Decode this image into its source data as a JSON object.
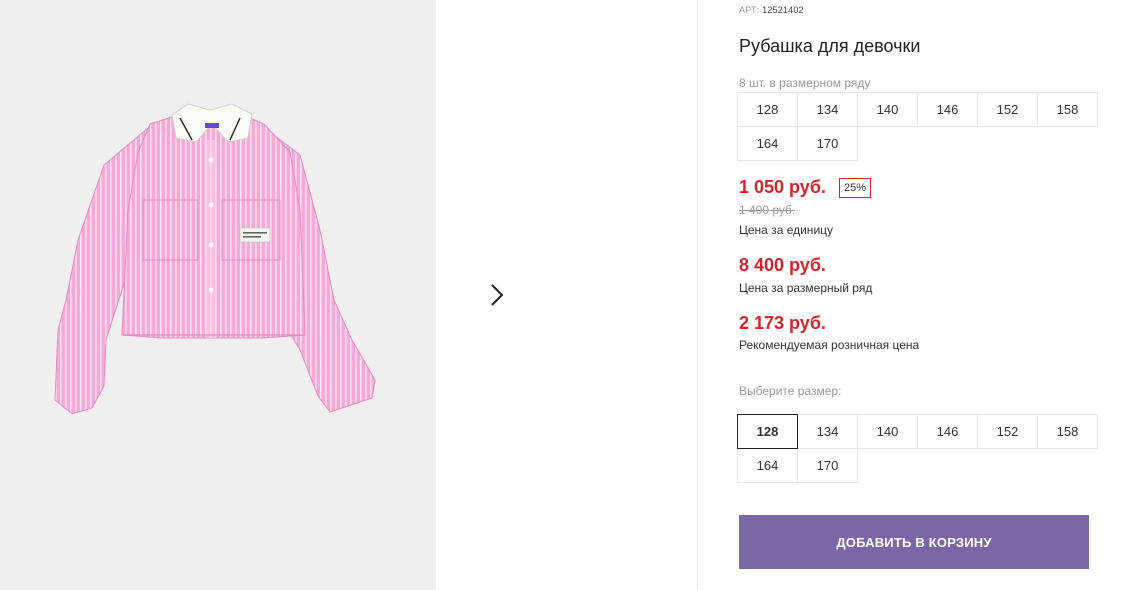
{
  "product": {
    "art_label": "АРТ:",
    "art_number": "12521402",
    "title": "Рубашка для девочки",
    "pack_note": "8 шт. в размерном ряду",
    "pack_sizes": [
      "128",
      "134",
      "140",
      "146",
      "152",
      "158",
      "164",
      "170"
    ]
  },
  "pricing": {
    "unit_price": "1 050 руб.",
    "discount": "25%",
    "old_price": "1 400 руб.",
    "unit_caption": "Цена за единицу",
    "pack_price": "8 400 руб.",
    "pack_caption": "Цена за размерный ряд",
    "retail_price": "2 173 руб.",
    "retail_caption": "Рекомендуемая розничная цена"
  },
  "size_select": {
    "label": "Выберите размер:",
    "options": [
      "128",
      "134",
      "140",
      "146",
      "152",
      "158",
      "164",
      "170"
    ],
    "selected": "128"
  },
  "cart": {
    "button_label": "ДОБАВИТЬ В КОРЗИНУ"
  },
  "gallery": {
    "next_icon": "chevron-right-icon"
  },
  "colors": {
    "price_red": "#d8232a",
    "cart_button": "#7b66a8",
    "photo_bg": "#efefef"
  }
}
